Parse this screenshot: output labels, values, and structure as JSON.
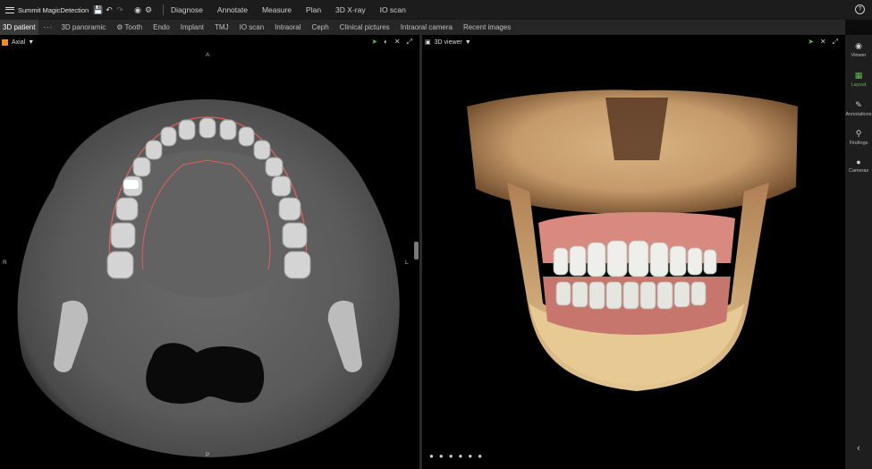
{
  "app": {
    "title": "Summit MagicDetection"
  },
  "toolbar": {
    "icons": [
      "save-icon",
      "undo-icon",
      "redo-icon",
      "globe-icon",
      "settings-icon"
    ],
    "menus": [
      "Diagnose",
      "Annotate",
      "Measure",
      "Plan",
      "3D X-ray",
      "IO scan"
    ],
    "help": "?"
  },
  "tabs": {
    "active": "3D patient",
    "more": "···",
    "items": [
      "3D panoramic",
      "Tooth",
      "Endo",
      "Implant",
      "TMJ",
      "IO scan",
      "Intraoral",
      "Ceph",
      "Clinical pictures",
      "Intraoral camera",
      "Recent images"
    ]
  },
  "left_panel": {
    "view_label": "Axial",
    "orient": {
      "top": "A",
      "bottom": "P",
      "left": "R",
      "right": "L"
    }
  },
  "right_panel": {
    "view_label": "3D viewer"
  },
  "sidebar": {
    "items": [
      {
        "label": "Viewer",
        "icon": "eye-icon"
      },
      {
        "label": "Layout",
        "icon": "layout-icon",
        "active": true
      },
      {
        "label": "Annotations",
        "icon": "pen-icon"
      },
      {
        "label": "Findings",
        "icon": "search-icon"
      },
      {
        "label": "Cameras",
        "icon": "camera-icon"
      }
    ],
    "collapse": "‹"
  },
  "colors": {
    "accent": "#5fbf4a",
    "axial_swatch": "#f08c2a"
  }
}
